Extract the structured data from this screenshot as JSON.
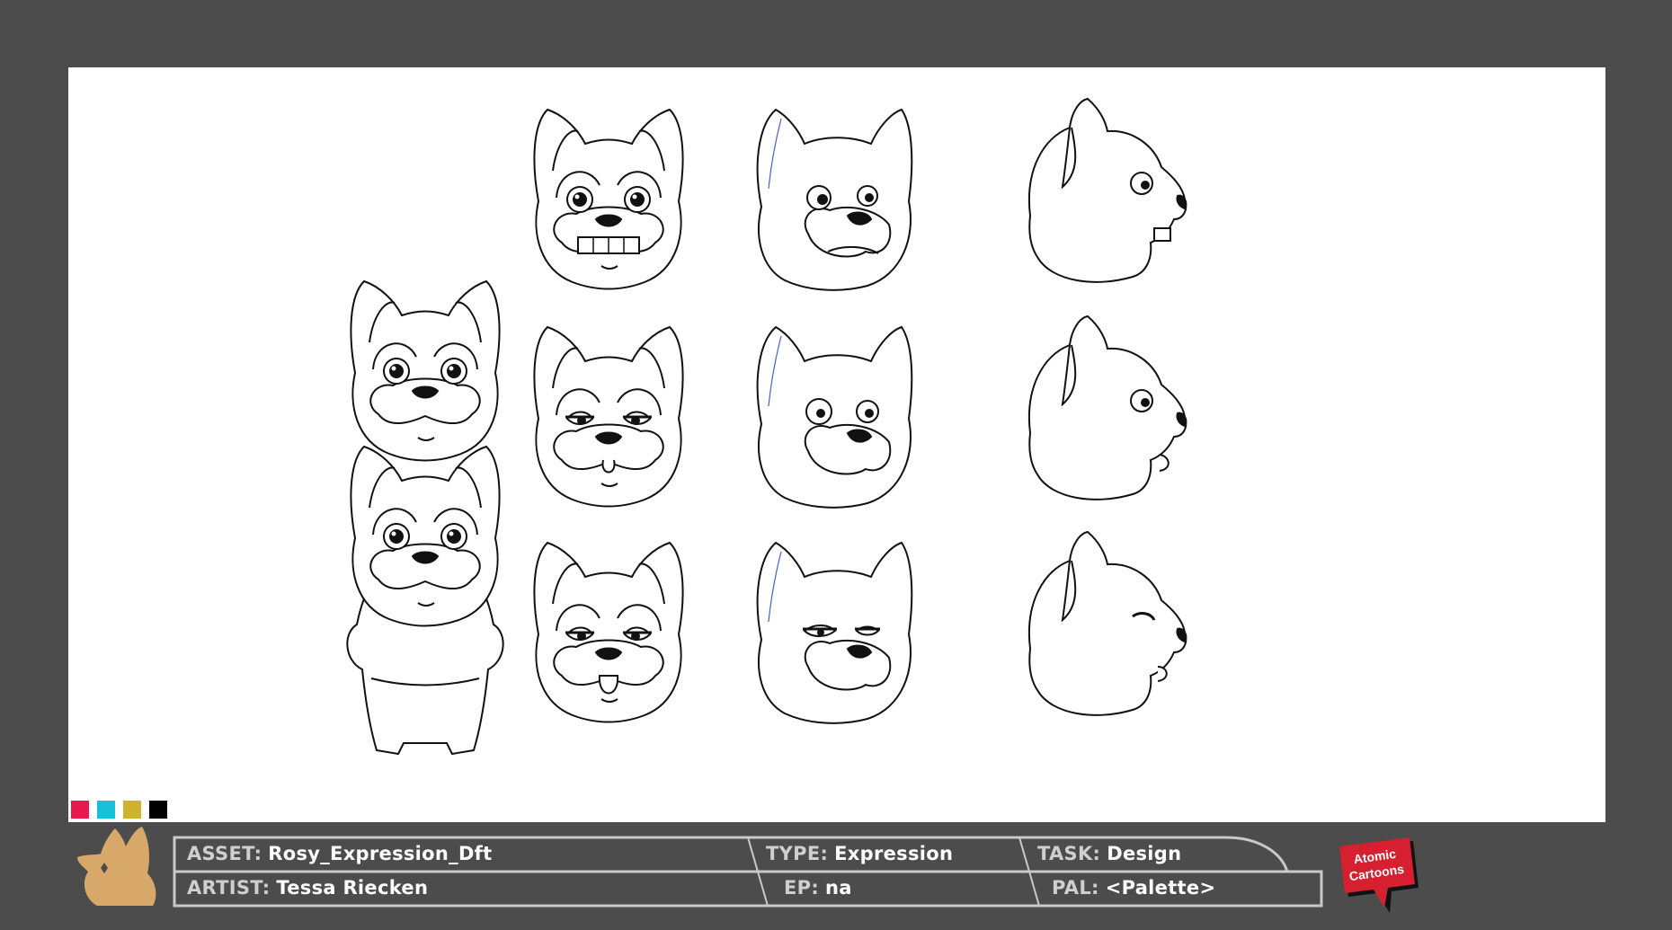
{
  "colors": {
    "frame": "#4c4c4c",
    "canvas": "#ffffff",
    "line_art": "#111111",
    "construction_line": "#4a5bd6",
    "footer_icon": "#d8a86a",
    "logo_red": "#d6202f"
  },
  "swatches": [
    "#e8194f",
    "#17bfd8",
    "#cfb32a",
    "#000000"
  ],
  "sheet": {
    "subject": "cartoon dog expression sheet",
    "character_poses": [
      "front head",
      "front full body"
    ],
    "expression_grid_rows": 3,
    "expression_grid_cols": 3
  },
  "footer": {
    "icon": "dog-head-icon",
    "asset_label": "ASSET:",
    "asset_value": "Rosy_Expression_Dft",
    "type_label": "TYPE:",
    "type_value": "Expression",
    "task_label": "TASK:",
    "task_value": "Design",
    "artist_label": "ARTIST:",
    "artist_value": "Tessa Riecken",
    "ep_label": "EP:",
    "ep_value": "na",
    "pal_label": "PAL:",
    "pal_value": "<Palette>",
    "logo_line1": "Atomic",
    "logo_line2": "Cartoons"
  }
}
